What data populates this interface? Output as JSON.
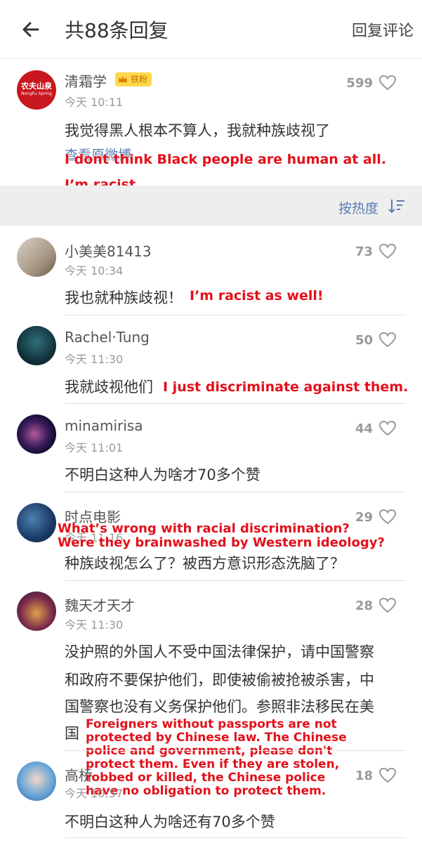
{
  "header": {
    "title": "共88条回复",
    "action": "回复评论"
  },
  "top_comment": {
    "user": "清霜学",
    "badge": "铁粉",
    "time": "今天 10:11",
    "likes": "599",
    "text": "我觉得黑人根本不算人，我就种族歧视了",
    "view_link": "查看原微博",
    "avatar_text": "农夫山泉",
    "avatar_sub": "NongFu Spring"
  },
  "sort": {
    "label": "按热度"
  },
  "comments": [
    {
      "user": "小美美81413",
      "time": "今天 10:34",
      "likes": "73",
      "text": "我也就种族歧视！"
    },
    {
      "user": "Rachel·Tung",
      "time": "今天 11:30",
      "likes": "50",
      "text": "我就歧视他们"
    },
    {
      "user": "minamirisa",
      "time": "今天 11:01",
      "likes": "44",
      "text": "不明白这种人为啥才70多个赞"
    },
    {
      "user": "时点电影",
      "time": "今天 11:16",
      "likes": "29",
      "text": "种族歧视怎么了？被西方意识形态洗脑了？"
    },
    {
      "user": "魏天才天才",
      "time": "今天 11:30",
      "likes": "28",
      "text_lines": [
        "没护照的外国人不受中国法律保护，请中国警察",
        "和政府不要保护他们，即使被偷被抢被杀害，中",
        "国警察也没有义务保护他们。参照非法移民在美",
        "国"
      ]
    },
    {
      "user": "高桥",
      "time": "今天 10:57",
      "likes": "18",
      "text": "不明白这种人为啥还有70多个赞"
    }
  ],
  "overlays": {
    "o1_line1": "I dont think Black people are human at all.",
    "o1_line2": "I’m racist.",
    "o2": "I’m racist as well!",
    "o3": "I just discriminate against them.",
    "o4_line1": "What’s wrong with racial discrimination?",
    "o4_line2": "Were they brainwashed by Western ideology?",
    "o5_lines": [
      "Foreigners without passports are not",
      "protected by Chinese law. The Chinese",
      "police and government, please don't",
      "protect them. Even if they are stolen,",
      "robbed or killed, the Chinese police",
      "have no obligation to protect them."
    ]
  },
  "colors": {
    "overlay": "#e3101a",
    "link": "#5a7db3",
    "sortbar": "#eeeeee"
  }
}
